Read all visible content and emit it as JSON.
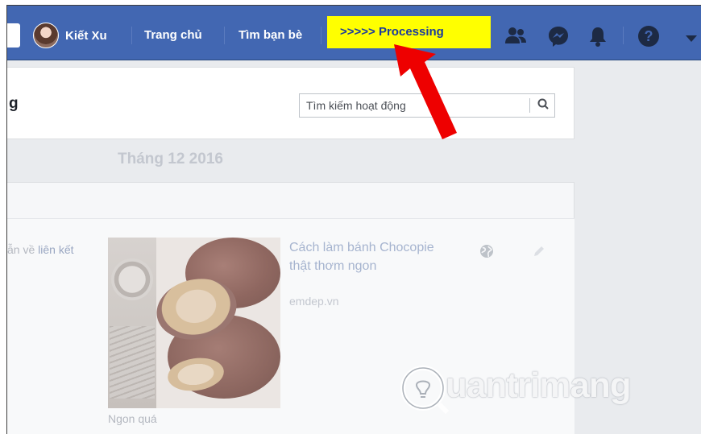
{
  "topbar": {
    "profile_name": "Kiết Xu",
    "nav_home": "Trang chủ",
    "nav_find_friends": "Tìm bạn bè",
    "processing_label": ">>>>> Processing",
    "bg_color": "#4267b2",
    "icons": [
      "friends-icon",
      "messenger-icon",
      "notifications-icon",
      "help-icon",
      "caret-down-icon"
    ]
  },
  "header": {
    "title": "g",
    "search_placeholder": "Tìm kiếm hoạt động"
  },
  "timeline": {
    "month": "Tháng 12 2016"
  },
  "post": {
    "shared_prefix": "ẫn về ",
    "shared_link": "liên kết",
    "photo_caption": "Ngon quá",
    "link_title": "Cách làm bánh Chocopie thật thơm ngon",
    "link_domain": "emdep.vn",
    "privacy_icon": "globe-icon",
    "edit_icon": "pencil-icon"
  },
  "annotation": {
    "arrow_color": "#ee0000",
    "highlight_color": "#ffff00"
  },
  "watermark": {
    "text": "uantrimang"
  }
}
